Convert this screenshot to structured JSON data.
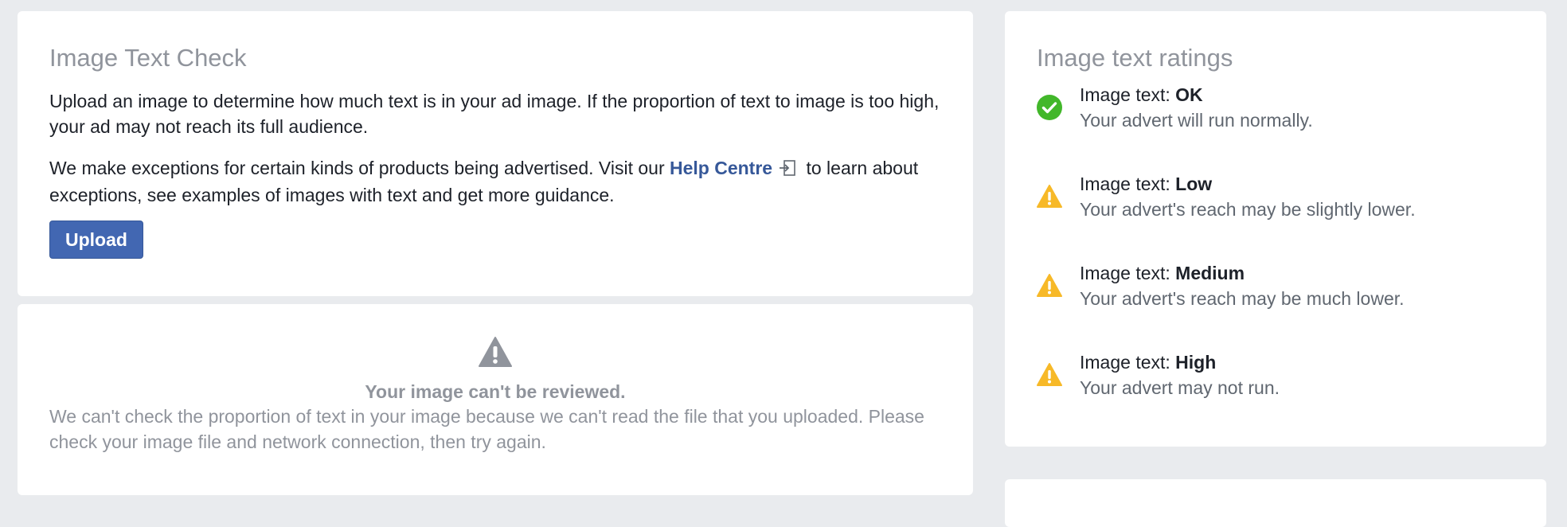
{
  "check": {
    "title": "Image Text Check",
    "para1": "Upload an image to determine how much text is in your ad image. If the proportion of text to image is too high, your ad may not reach its full audience.",
    "para2_before": "We make exceptions for certain kinds of products being advertised. Visit our ",
    "para2_link": "Help Centre",
    "para2_after": " to learn about exceptions, see examples of images with text and get more guidance.",
    "upload_label": "Upload"
  },
  "error": {
    "title": "Your image can't be reviewed.",
    "body": "We can't check the proportion of text in your image because we can't read the file that you uploaded. Please check your image file and network connection, then try again."
  },
  "ratings": {
    "title": "Image text ratings",
    "items": [
      {
        "prefix": "Image text: ",
        "level": "OK",
        "desc": "Your advert will run normally.",
        "icon": "check-circle-icon",
        "color": "#42b72a"
      },
      {
        "prefix": "Image text: ",
        "level": "Low",
        "desc": "Your advert's reach may be slightly lower.",
        "icon": "warning-icon",
        "color": "#f7b928"
      },
      {
        "prefix": "Image text: ",
        "level": "Medium",
        "desc": "Your advert's reach may be much lower.",
        "icon": "warning-icon",
        "color": "#f7b928"
      },
      {
        "prefix": "Image text: ",
        "level": "High",
        "desc": "Your advert may not run.",
        "icon": "warning-icon",
        "color": "#f7b928"
      }
    ]
  },
  "colors": {
    "background": "#e9ebee",
    "link": "#365899",
    "button": "#4267b2",
    "ok": "#42b72a",
    "warning": "#f7b928",
    "muted": "#90949c"
  }
}
